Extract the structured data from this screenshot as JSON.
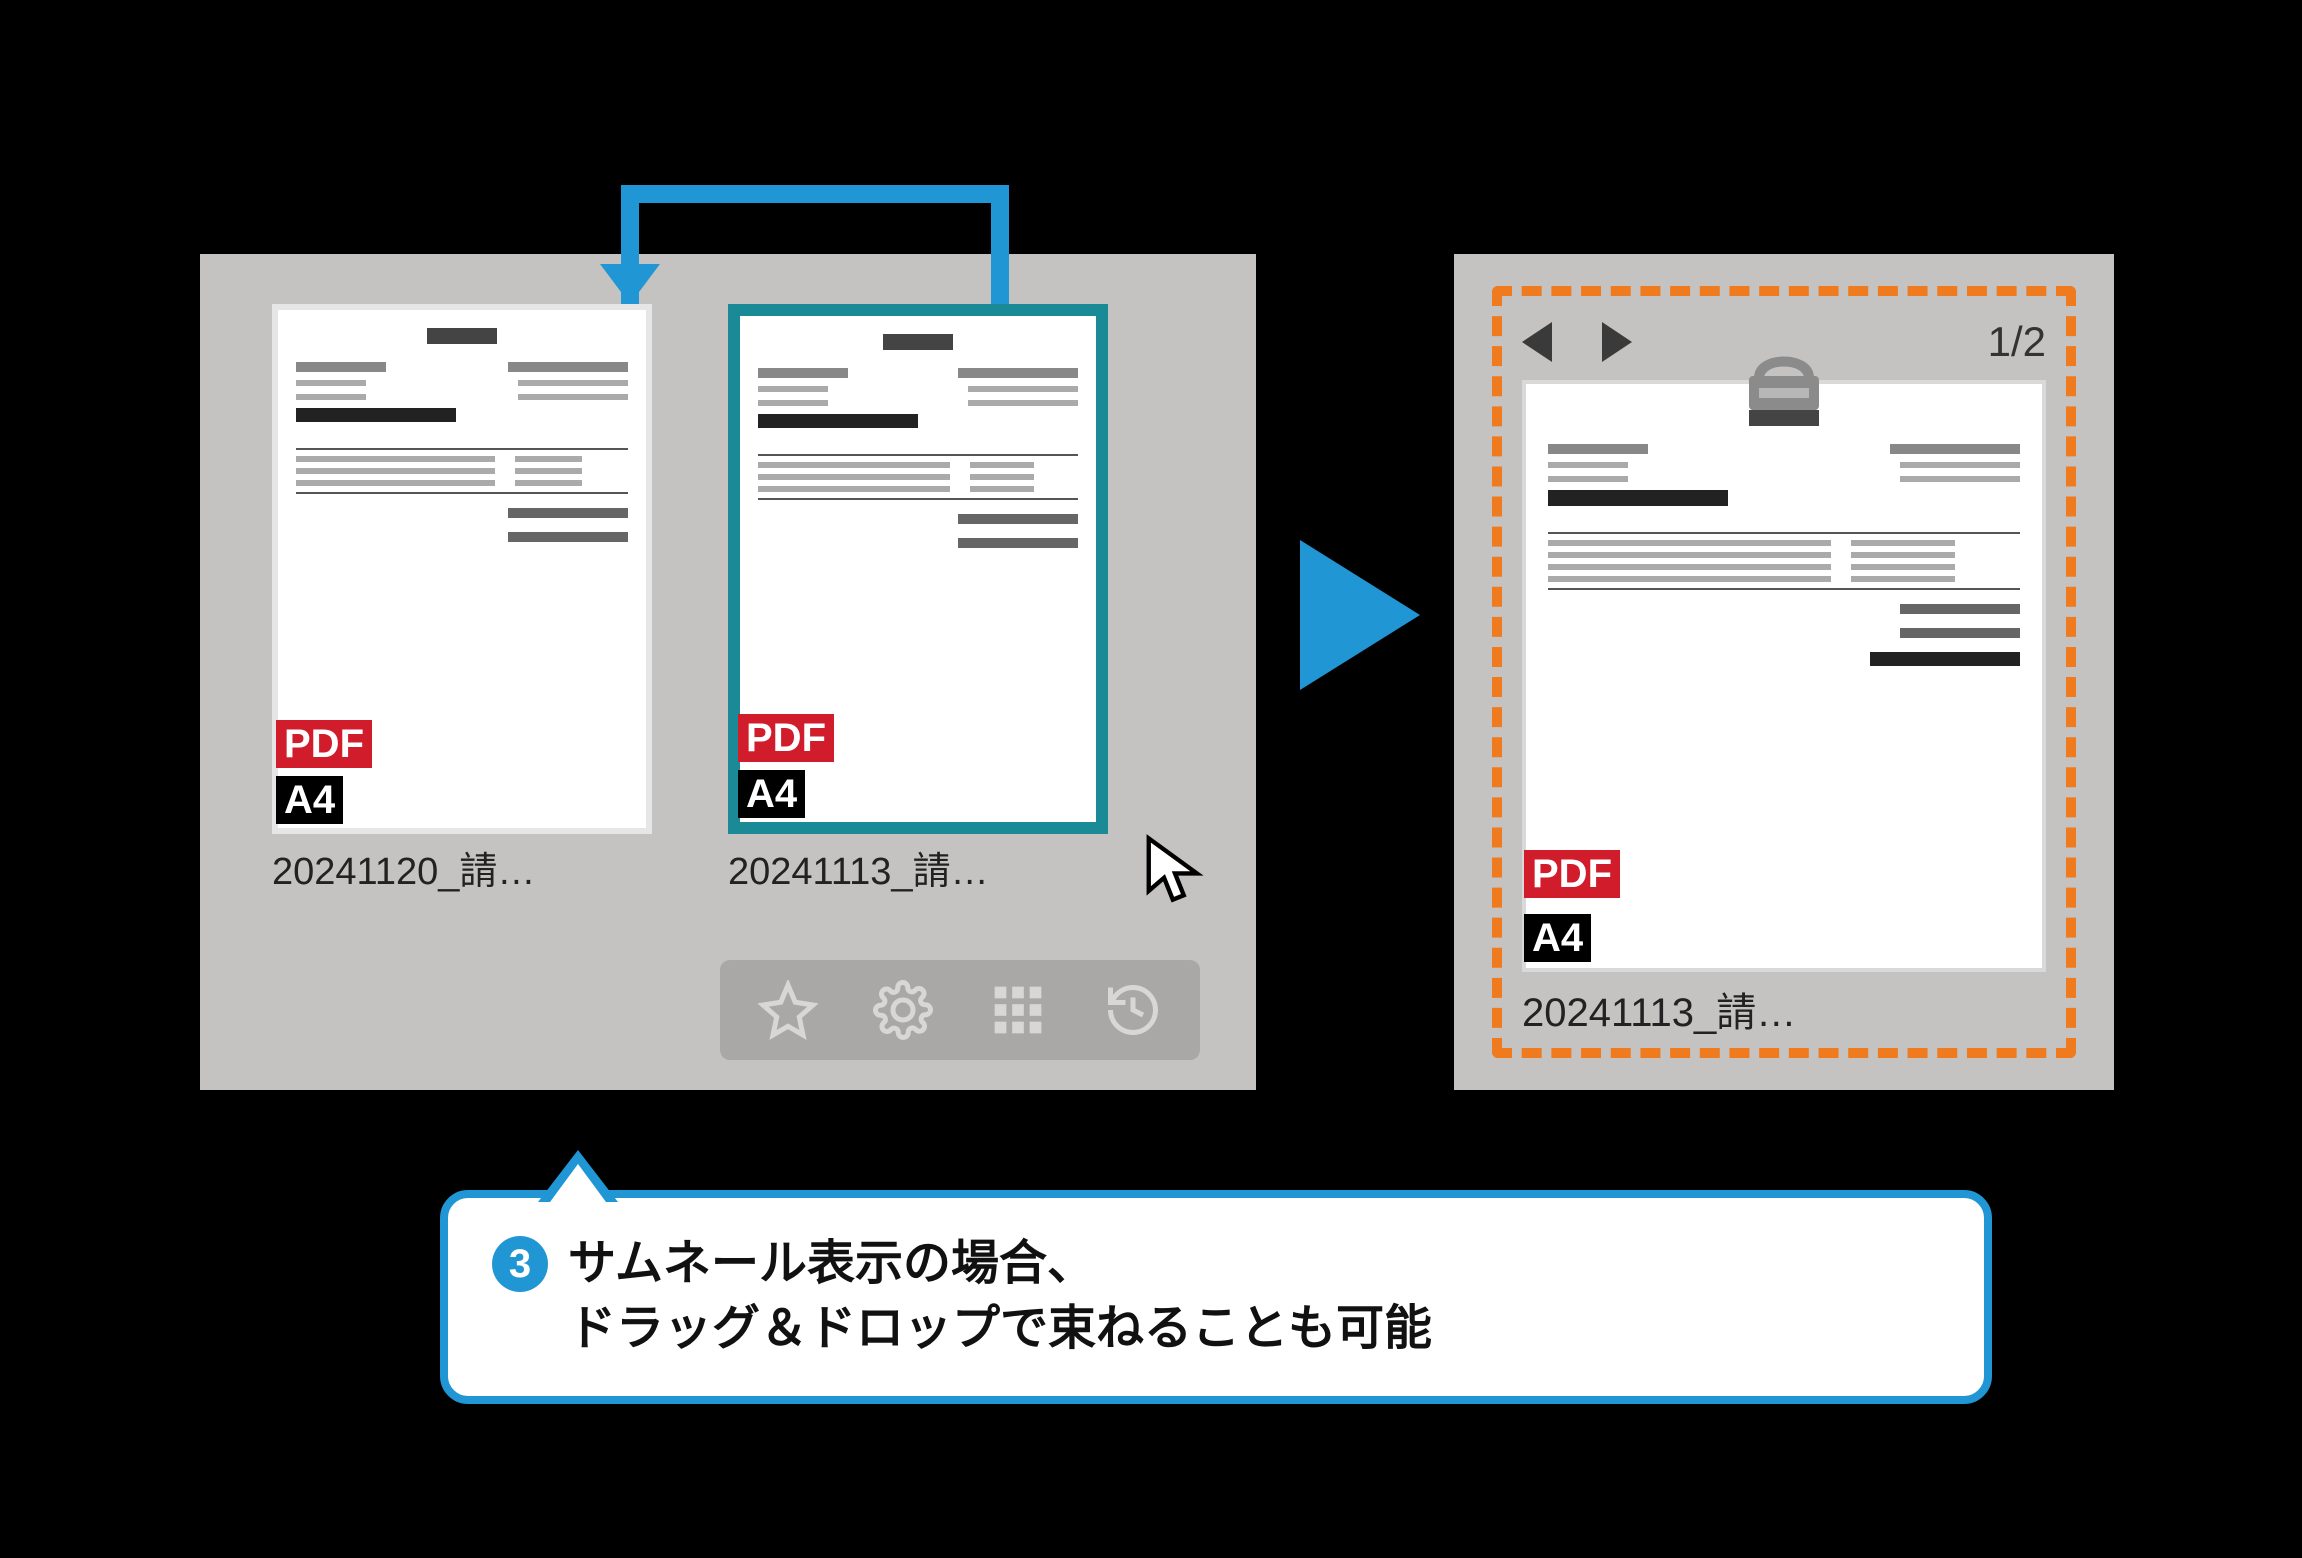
{
  "left_panel": {
    "thumbnails": [
      {
        "filename": "20241120_請…",
        "pdf_badge": "PDF",
        "size_badge": "A4",
        "selected": false
      },
      {
        "filename": "20241113_請…",
        "pdf_badge": "PDF",
        "size_badge": "A4",
        "selected": true
      }
    ],
    "toolbar": {
      "star": "star-icon",
      "gear": "gear-icon",
      "grid": "grid-icon",
      "history": "history-icon"
    }
  },
  "right_panel": {
    "page_counter": "1/2",
    "filename": "20241113_請…",
    "pdf_badge": "PDF",
    "size_badge": "A4"
  },
  "callout": {
    "number": "3",
    "line1": "サムネール表示の場合、",
    "line2": "ドラッグ＆ドロップで束ねることも可能"
  },
  "colors": {
    "accent_blue": "#2196d4",
    "teal_select": "#1a8a97",
    "orange_dash": "#f07b1e",
    "pdf_red": "#d11c2b"
  }
}
